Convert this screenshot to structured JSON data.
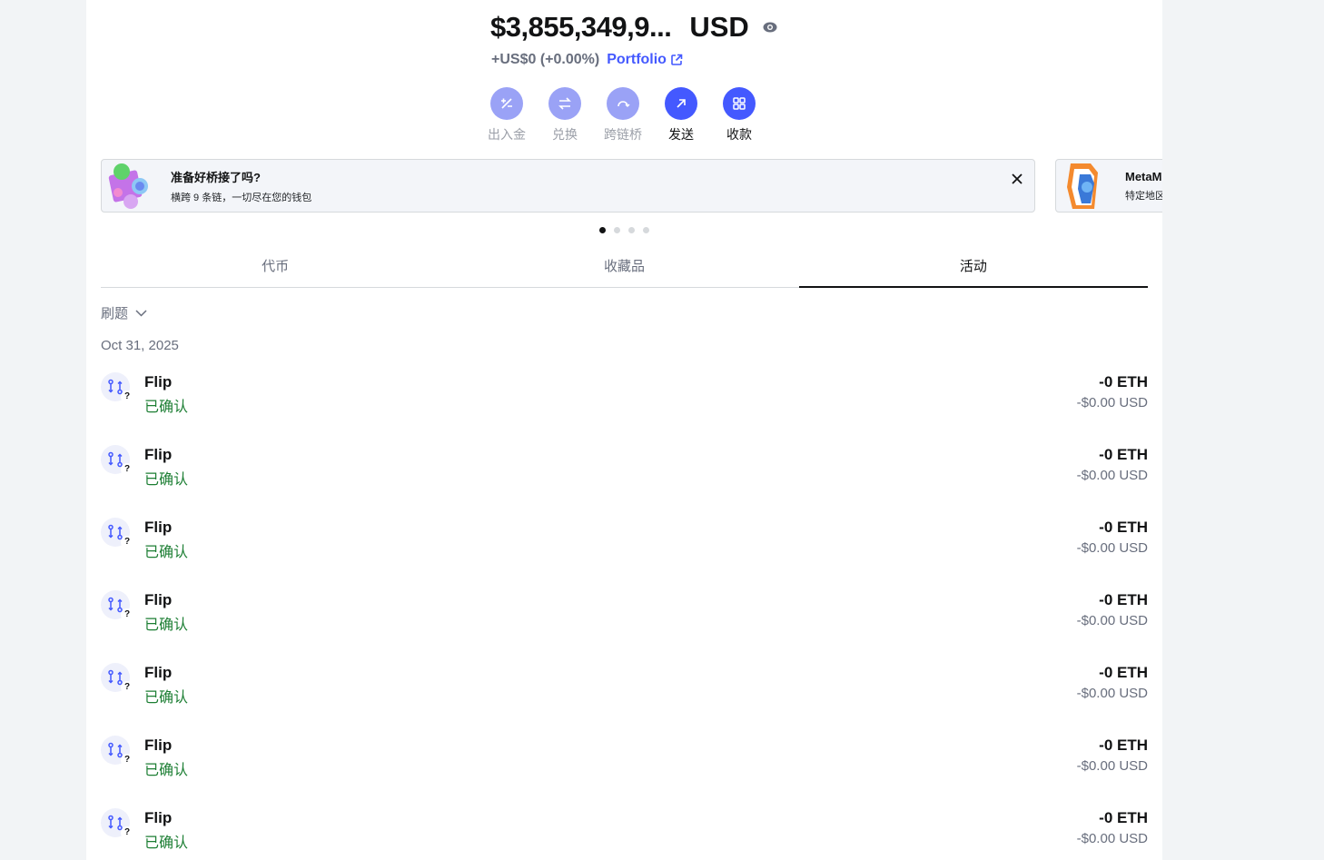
{
  "header": {
    "balance": "$3,855,349,9...",
    "currency": "USD",
    "change": "+US$0 (+0.00%)",
    "portfolio_label": "Portfolio"
  },
  "actions": [
    {
      "label": "出入金",
      "icon": "plus-minus-icon",
      "enabled": false
    },
    {
      "label": "兑换",
      "icon": "swap-icon",
      "enabled": false
    },
    {
      "label": "跨链桥",
      "icon": "bridge-icon",
      "enabled": false
    },
    {
      "label": "发送",
      "icon": "send-arrow-icon",
      "enabled": true
    },
    {
      "label": "收款",
      "icon": "qr-code-icon",
      "enabled": true
    }
  ],
  "banners": [
    {
      "title": "准备好桥接了吗?",
      "subtitle": "横跨 9 条链，一切尽在您的钱包"
    },
    {
      "title": "MetaM",
      "subtitle": "特定地区"
    }
  ],
  "tabs": [
    {
      "label": "代币",
      "active": false
    },
    {
      "label": "收藏品",
      "active": false
    },
    {
      "label": "活动",
      "active": true
    }
  ],
  "filter": {
    "label": "刷题"
  },
  "date_group": "Oct 31, 2025",
  "activities": [
    {
      "name": "Flip",
      "status": "已确认",
      "amount": "-0 ETH",
      "usd": "-$0.00 USD"
    },
    {
      "name": "Flip",
      "status": "已确认",
      "amount": "-0 ETH",
      "usd": "-$0.00 USD"
    },
    {
      "name": "Flip",
      "status": "已确认",
      "amount": "-0 ETH",
      "usd": "-$0.00 USD"
    },
    {
      "name": "Flip",
      "status": "已确认",
      "amount": "-0 ETH",
      "usd": "-$0.00 USD"
    },
    {
      "name": "Flip",
      "status": "已确认",
      "amount": "-0 ETH",
      "usd": "-$0.00 USD"
    },
    {
      "name": "Flip",
      "status": "已确认",
      "amount": "-0 ETH",
      "usd": "-$0.00 USD"
    },
    {
      "name": "Flip",
      "status": "已确认",
      "amount": "-0 ETH",
      "usd": "-$0.00 USD"
    }
  ],
  "colors": {
    "accent": "#4459ff",
    "accent_disabled": "#9aa2f6",
    "confirmed": "#1c7e33",
    "muted": "#686e7d"
  }
}
